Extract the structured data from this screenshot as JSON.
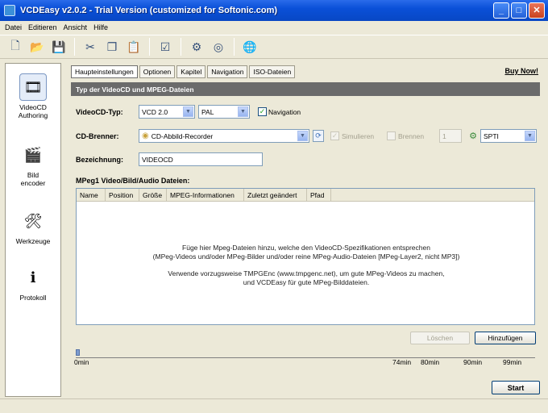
{
  "window": {
    "title": "VCDEasy v2.0.2 - Trial Version (customized for Softonic.com)"
  },
  "menu": [
    "Datei",
    "Editieren",
    "Ansicht",
    "Hilfe"
  ],
  "toolbar": [
    "new-icon",
    "open-icon",
    "save-icon",
    "cut-icon",
    "copy-icon",
    "paste-icon",
    "check-icon",
    "burn-icon",
    "disc-icon",
    "globe-icon"
  ],
  "nav": [
    {
      "label_line1": "VideoCD",
      "label_line2": "Authoring",
      "icon": "film-icon",
      "active": true
    },
    {
      "label_line1": "Bild",
      "label_line2": "encoder",
      "icon": "image-icon",
      "active": false
    },
    {
      "label_line1": "Werkzeuge",
      "label_line2": "",
      "icon": "tools-icon",
      "active": false
    },
    {
      "label_line1": "Protokoll",
      "label_line2": "",
      "icon": "log-icon",
      "active": false
    }
  ],
  "tabs": [
    "Haupteinstellungen",
    "Optionen",
    "Kapitel",
    "Navigation",
    "ISO-Dateien"
  ],
  "buy_link": "Buy Now!",
  "section_title": "Typ der VideoCD und MPEG-Dateien",
  "videocd": {
    "label": "VideoCD-Typ:",
    "type_value": "VCD 2.0",
    "norm_value": "PAL",
    "navigation_label": "Navigation",
    "navigation_checked": true
  },
  "burner": {
    "label": "CD-Brenner:",
    "value": "CD-Abbild-Recorder",
    "simulate_label": "Simulieren",
    "burn_label": "Brennen",
    "speed_value": "1",
    "interface_value": "SPTI"
  },
  "name": {
    "label": "Bezeichnung:",
    "value": "VIDEOCD"
  },
  "files": {
    "title": "MPeg1 Video/Bild/Audio Dateien:",
    "columns": [
      "Name",
      "Position",
      "Größe",
      "MPEG-Informationen",
      "Zuletzt geändert",
      "Pfad"
    ],
    "empty_line1": "Füge hier Mpeg-Dateien hinzu, welche den VideoCD-Spezifikationen entsprechen",
    "empty_line2": "(MPeg-Videos und/oder MPeg-Bilder und/oder reine MPeg-Audio-Dateien [MPeg-Layer2, nicht MP3])",
    "empty_line3": "Verwende vorzugsweise TMPGEnc (www.tmpgenc.net), um gute MPeg-Videos zu machen,",
    "empty_line4": "und VCDEasy für gute MPeg-Bilddateien."
  },
  "buttons": {
    "remove": "Löschen",
    "add": "Hinzufügen",
    "start": "Start"
  },
  "timeline": {
    "fill_fraction": 0.008,
    "ticks": [
      "0min",
      "74min",
      "80min",
      "90min",
      "99min"
    ]
  }
}
